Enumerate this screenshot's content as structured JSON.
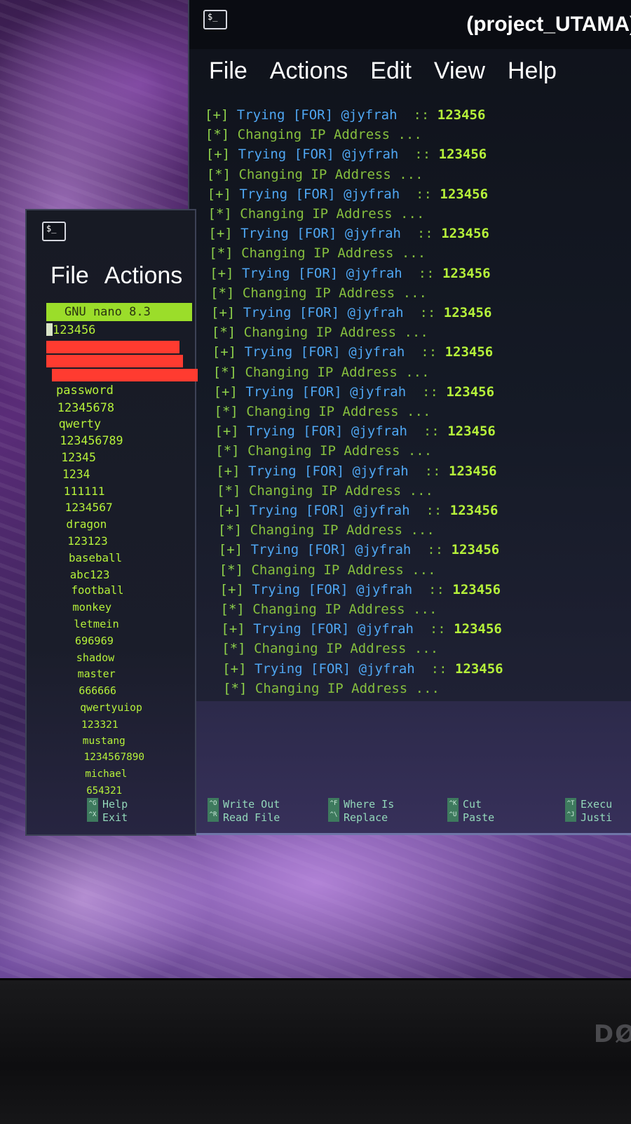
{
  "main_terminal": {
    "title": "(project_UTAMA)",
    "menu": [
      "File",
      "Actions",
      "Edit",
      "View",
      "Help"
    ],
    "log": [
      {
        "tag": "[+]",
        "text": "Trying [FOR] @jyfrah",
        "sep": "::",
        "value": "123456"
      },
      {
        "tag": "[*]",
        "text": "Changing IP Address ..."
      },
      {
        "tag": "[+]",
        "text": "Trying [FOR] @jyfrah",
        "sep": "::",
        "value": "123456"
      },
      {
        "tag": "[*]",
        "text": "Changing IP Address ..."
      },
      {
        "tag": "[+]",
        "text": "Trying [FOR] @jyfrah",
        "sep": "::",
        "value": "123456"
      },
      {
        "tag": "[*]",
        "text": "Changing IP Address ..."
      },
      {
        "tag": "[+]",
        "text": "Trying [FOR] @jyfrah",
        "sep": "::",
        "value": "123456"
      },
      {
        "tag": "[*]",
        "text": "Changing IP Address ..."
      },
      {
        "tag": "[+]",
        "text": "Trying [FOR] @jyfrah",
        "sep": "::",
        "value": "123456"
      },
      {
        "tag": "[*]",
        "text": "Changing IP Address ..."
      },
      {
        "tag": "[+]",
        "text": "Trying [FOR] @jyfrah",
        "sep": "::",
        "value": "123456"
      },
      {
        "tag": "[*]",
        "text": "Changing IP Address ..."
      },
      {
        "tag": "[+]",
        "text": "Trying [FOR] @jyfrah",
        "sep": "::",
        "value": "123456"
      },
      {
        "tag": "[*]",
        "text": "Changing IP Address ..."
      },
      {
        "tag": "[+]",
        "text": "Trying [FOR] @jyfrah",
        "sep": "::",
        "value": "123456"
      },
      {
        "tag": "[*]",
        "text": "Changing IP Address ..."
      },
      {
        "tag": "[+]",
        "text": "Trying [FOR] @jyfrah",
        "sep": "::",
        "value": "123456"
      },
      {
        "tag": "[*]",
        "text": "Changing IP Address ..."
      },
      {
        "tag": "[+]",
        "text": "Trying [FOR] @jyfrah",
        "sep": "::",
        "value": "123456"
      },
      {
        "tag": "[*]",
        "text": "Changing IP Address ..."
      },
      {
        "tag": "[+]",
        "text": "Trying [FOR] @jyfrah",
        "sep": "::",
        "value": "123456"
      },
      {
        "tag": "[*]",
        "text": "Changing IP Address ..."
      },
      {
        "tag": "[+]",
        "text": "Trying [FOR] @jyfrah",
        "sep": "::",
        "value": "123456"
      },
      {
        "tag": "[*]",
        "text": "Changing IP Address ..."
      },
      {
        "tag": "[+]",
        "text": "Trying [FOR] @jyfrah",
        "sep": "::",
        "value": "123456"
      },
      {
        "tag": "[*]",
        "text": "Changing IP Address ..."
      },
      {
        "tag": "[+]",
        "text": "Trying [FOR] @jyfrah",
        "sep": "::",
        "value": "123456"
      },
      {
        "tag": "[*]",
        "text": "Changing IP Address ..."
      },
      {
        "tag": "[+]",
        "text": "Trying [FOR] @jyfrah",
        "sep": "::",
        "value": "123456"
      },
      {
        "tag": "[*]",
        "text": "Changing IP Address ..."
      }
    ]
  },
  "nano_terminal": {
    "menu": [
      "File",
      "Actions"
    ],
    "header": "GNU nano 8.3",
    "first_line": "123456",
    "passwords": [
      "password",
      "12345678",
      "qwerty",
      "123456789",
      "12345",
      "1234",
      "111111",
      "1234567",
      "dragon",
      "123123",
      "baseball",
      "abc123",
      "football",
      "monkey",
      "letmein",
      "696969",
      "shadow",
      "master",
      "666666",
      "qwertyuiop",
      "123321",
      "mustang",
      "1234567890",
      "michael",
      "654321"
    ],
    "shortcuts": [
      {
        "keys": [
          "^G",
          "^X"
        ],
        "labels": [
          "Help",
          "Exit"
        ]
      },
      {
        "keys": [
          "^O",
          "^R"
        ],
        "labels": [
          "Write Out",
          "Read File"
        ]
      },
      {
        "keys": [
          "^F",
          "^\\"
        ],
        "labels": [
          "Where Is",
          "Replace"
        ]
      },
      {
        "keys": [
          "^K",
          "^U"
        ],
        "labels": [
          "Cut",
          "Paste"
        ]
      },
      {
        "keys": [
          "^T",
          "^J"
        ],
        "labels": [
          "Execu",
          "Justi"
        ]
      }
    ]
  },
  "colors": {
    "prompt_green": "#8fd24a",
    "trying_blue": "#4fa6f2",
    "password_green": "#b6f23a",
    "redaction_red": "#ff3b30",
    "nano_header_bg": "#9bdd2a"
  },
  "icons": [
    "terminal-icon"
  ],
  "brand": {
    "bezel_logo": "DØ"
  }
}
